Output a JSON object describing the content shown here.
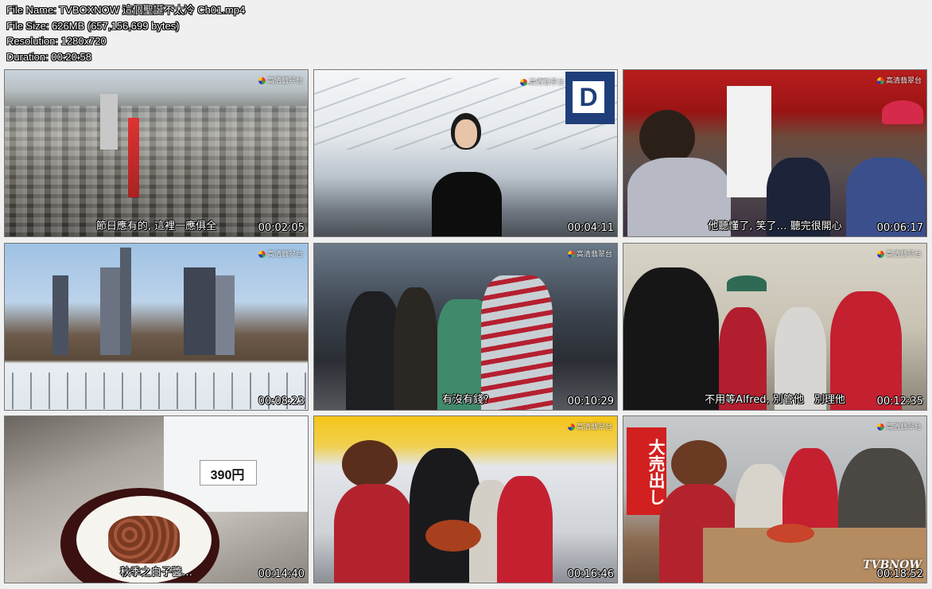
{
  "info": {
    "file_name": "File Name: TVBOXNOW 這個聖誕不太冷 Ch01.mp4",
    "file_size": "File Size: 626MB (657,156,699 bytes)",
    "resolution": "Resolution: 1280x720",
    "duration": "Duration: 00:20:58"
  },
  "channel_logo": "高清翡翠台",
  "watermark": "TVBNOW",
  "thumbnails": [
    {
      "timestamp": "00:02:05",
      "subtitle": "節日應有的, 這裡一應俱全",
      "scene": "city-aerial"
    },
    {
      "timestamp": "00:04:11",
      "subtitle": "",
      "scene": "airport-woman",
      "sign": "D"
    },
    {
      "timestamp": "00:06:17",
      "subtitle": "他聽懂了, 笑了… 聽完很開心",
      "scene": "restaurant"
    },
    {
      "timestamp": "00:08:23",
      "subtitle": "",
      "scene": "ice-rink"
    },
    {
      "timestamp": "00:10:29",
      "subtitle": "有沒有錢?",
      "scene": "times-square"
    },
    {
      "timestamp": "00:12:35",
      "subtitle": "不用等Alfred, 別管他　別理他",
      "scene": "street-group"
    },
    {
      "timestamp": "00:14:40",
      "subtitle": "秋季之白子醬…",
      "scene": "food-plate",
      "price": "390円"
    },
    {
      "timestamp": "00:16:46",
      "subtitle": "",
      "scene": "market-crab"
    },
    {
      "timestamp": "00:18:52",
      "subtitle": "",
      "scene": "seafood-table",
      "banner": "大売出し"
    }
  ]
}
